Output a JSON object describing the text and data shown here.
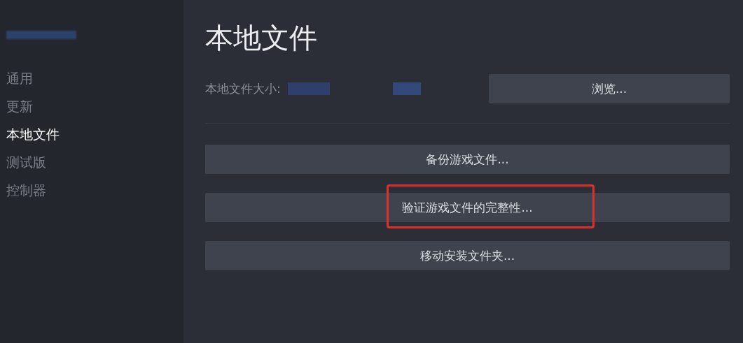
{
  "sidebar": {
    "items": [
      {
        "label": "通用",
        "selected": false
      },
      {
        "label": "更新",
        "selected": false
      },
      {
        "label": "本地文件",
        "selected": true
      },
      {
        "label": "测试版",
        "selected": false
      },
      {
        "label": "控制器",
        "selected": false
      }
    ]
  },
  "page": {
    "title": "本地文件",
    "size_label": "本地文件大小:",
    "browse_button": "浏览...",
    "actions": [
      {
        "label": "备份游戏文件...",
        "highlighted": false
      },
      {
        "label": "验证游戏文件的完整性...",
        "highlighted": true
      },
      {
        "label": "移动安装文件夹...",
        "highlighted": false
      }
    ]
  }
}
